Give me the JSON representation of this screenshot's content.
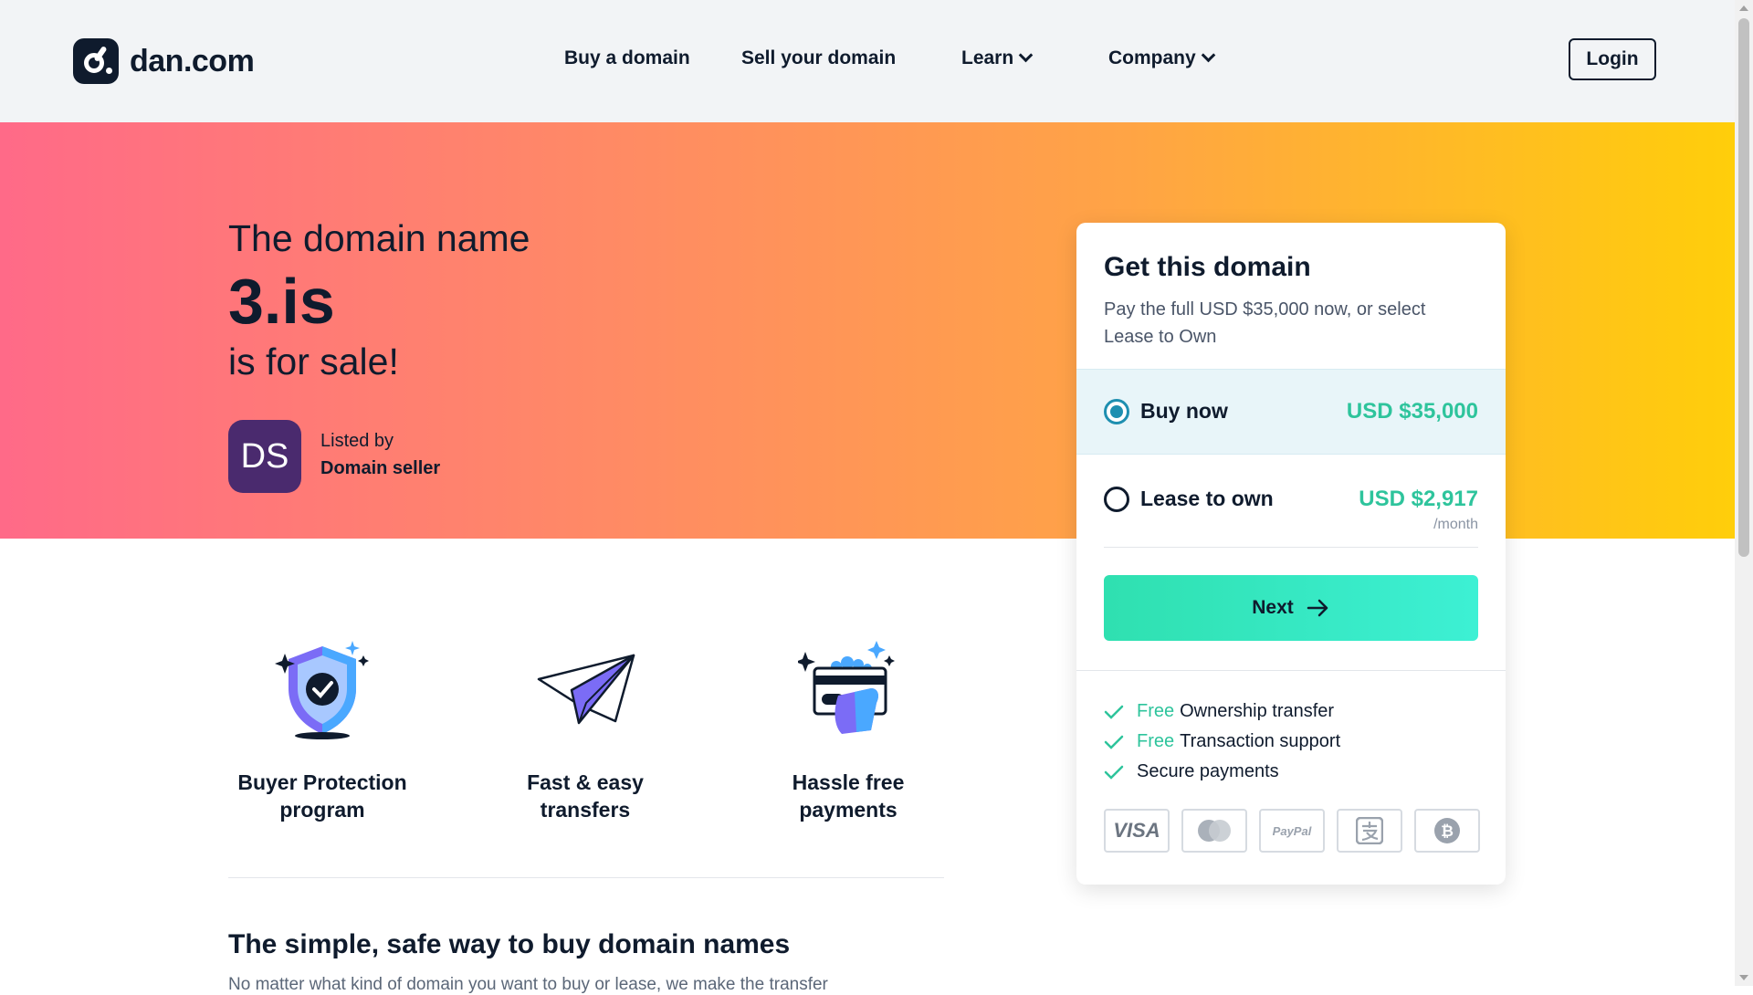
{
  "header": {
    "logo_text": "dan.com",
    "nav": [
      "Buy a domain",
      "Sell your domain",
      "Learn",
      "Company"
    ],
    "login": "Login"
  },
  "hero": {
    "pre": "The domain name",
    "domain": "3.is",
    "post": "is for sale!",
    "avatar_initials": "DS",
    "listed_by": "Listed by",
    "seller": "Domain seller"
  },
  "features": [
    {
      "icon": "shield-check-icon",
      "line1": "Buyer Protection",
      "line2": "program"
    },
    {
      "icon": "paper-plane-icon",
      "line1": "Fast & easy",
      "line2": "transfers"
    },
    {
      "icon": "card-payment-icon",
      "line1": "Hassle free",
      "line2": "payments"
    }
  ],
  "section": {
    "title": "The simple, safe way to buy domain names",
    "body": "No matter what kind of domain you want to buy or lease, we make the transfer"
  },
  "card": {
    "title": "Get this domain",
    "subtitle": "Pay the full USD $35,000 now, or select Lease to Own",
    "buy_label": "Buy now",
    "buy_price": "USD $35,000",
    "lease_label": "Lease to own",
    "lease_price": "USD $2,917",
    "lease_period": "/month",
    "next": "Next",
    "perks": [
      {
        "free": "Free",
        "text": "Ownership transfer"
      },
      {
        "free": "Free",
        "text": "Transaction support"
      },
      {
        "free": "",
        "text": "Secure payments"
      }
    ],
    "payment_methods": [
      "VISA",
      "Mastercard",
      "PayPal",
      "Alipay",
      "Bitcoin"
    ]
  },
  "colors": {
    "navy": "#0f1b2d",
    "accent_green": "#2ec49c",
    "radio_blue": "#1e8fb0",
    "hero_gradient": [
      "#ff6a88",
      "#ffa445",
      "#ffce0a"
    ]
  }
}
